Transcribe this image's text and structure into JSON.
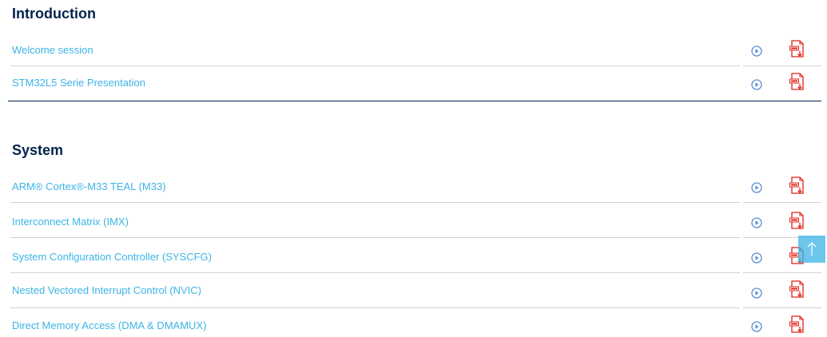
{
  "sections": [
    {
      "title": "Introduction",
      "items": [
        {
          "label": "Welcome session"
        },
        {
          "label": "STM32L5 Serie Presentation"
        }
      ]
    },
    {
      "title": "System",
      "items": [
        {
          "label": "ARM® Cortex®-M33 TEAL (M33)"
        },
        {
          "label": "Interconnect Matrix (IMX)"
        },
        {
          "label": "System Configuration Controller (SYSCFG)"
        },
        {
          "label": "Nested Vectored Interrupt Control (NVIC)"
        },
        {
          "label": "Direct Memory Access (DMA & DMAMUX)"
        }
      ]
    }
  ],
  "icons": {
    "play": "play-circle-icon",
    "pdf": "pdf-download-icon",
    "scroll_top": "arrow-up-icon"
  },
  "colors": {
    "link": "#3cb4e6",
    "heading": "#03234b",
    "play_icon": "#5a8fd6",
    "pdf_icon": "#e2231a",
    "divider": "#d2d2d2",
    "scroll_top_bg": "#3cb4e6"
  }
}
